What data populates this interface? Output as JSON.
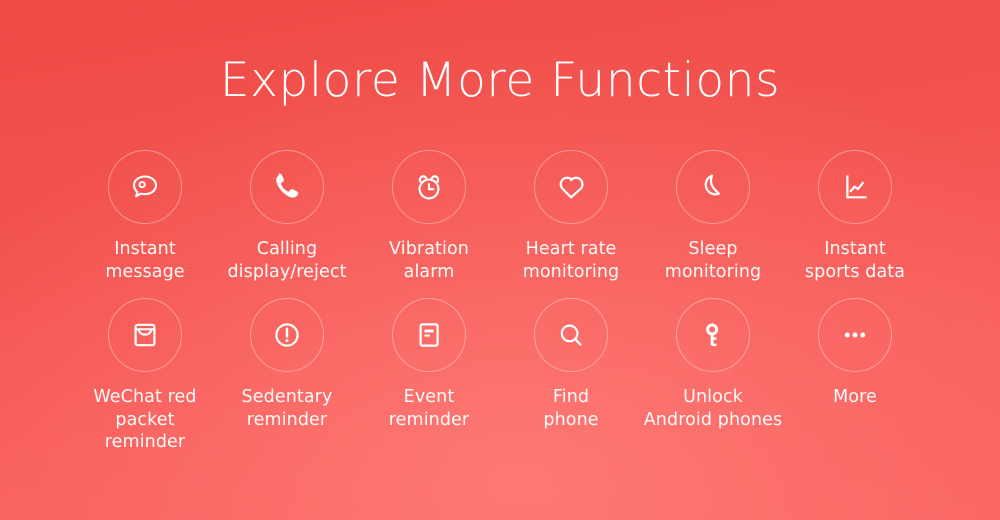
{
  "banner": {
    "headline": "Explore More Functions",
    "background_color_top": "#ef4a44",
    "background_color_bottom": "#fa6563",
    "text_color": "#ffffff",
    "ring_color": "rgba(255,255,255,0.38)"
  },
  "features": [
    {
      "id": "instant-message",
      "icon": "speech-bubble-icon",
      "label": "Instant\nmessage"
    },
    {
      "id": "calling-display-reject",
      "icon": "phone-handset-icon",
      "label": "Calling\ndisplay/reject"
    },
    {
      "id": "vibration-alarm",
      "icon": "alarm-clock-icon",
      "label": "Vibration\nalarm"
    },
    {
      "id": "heart-rate-monitoring",
      "icon": "heart-icon",
      "label": "Heart rate\nmonitoring"
    },
    {
      "id": "sleep-monitoring",
      "icon": "crescent-moon-icon",
      "label": "Sleep\nmonitoring"
    },
    {
      "id": "instant-sports-data",
      "icon": "line-chart-icon",
      "label": "Instant\nsports data"
    },
    {
      "id": "wechat-red-packet-reminder",
      "icon": "envelope-icon",
      "label": "WeChat red\npacket reminder"
    },
    {
      "id": "sedentary-reminder",
      "icon": "exclamation-circle-icon",
      "label": "Sedentary\nreminder"
    },
    {
      "id": "event-reminder",
      "icon": "document-lines-icon",
      "label": "Event\nreminder"
    },
    {
      "id": "find-phone",
      "icon": "magnifier-icon",
      "label": "Find\nphone"
    },
    {
      "id": "unlock-android-phones",
      "icon": "key-icon",
      "label": "Unlock\nAndroid phones"
    },
    {
      "id": "more",
      "icon": "ellipsis-icon",
      "label": "More"
    }
  ]
}
